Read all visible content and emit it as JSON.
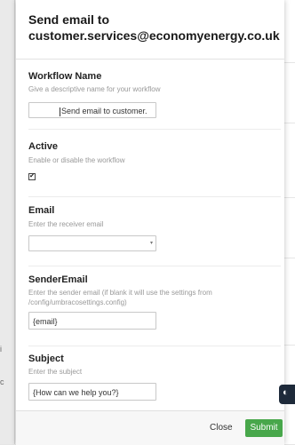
{
  "panel": {
    "title": "Send email to customer.services@economyenergy.co.uk"
  },
  "fields": {
    "workflow_name": {
      "label": "Workflow Name",
      "description": "Give a descriptive name for your workflow",
      "value": "Send email to customer."
    },
    "active": {
      "label": "Active",
      "description": "Enable or disable the workflow",
      "checked_glyph": "✔"
    },
    "email": {
      "label": "Email",
      "description": "Enter the receiver email",
      "value": ""
    },
    "sender_email": {
      "label": "SenderEmail",
      "description": "Enter the sender email (if blank it will use the settings from /config/umbracosettings.config)",
      "value": "{email}"
    },
    "subject": {
      "label": "Subject",
      "description": "Enter the subject",
      "value": "{How can we help you?}"
    }
  },
  "footer": {
    "close_label": "Close",
    "submit_label": "Submit"
  },
  "background": {
    "left_marks": [
      "i",
      "c"
    ]
  },
  "colors": {
    "submit": "#48a74b",
    "edge_icon": "#1e2a3a"
  }
}
